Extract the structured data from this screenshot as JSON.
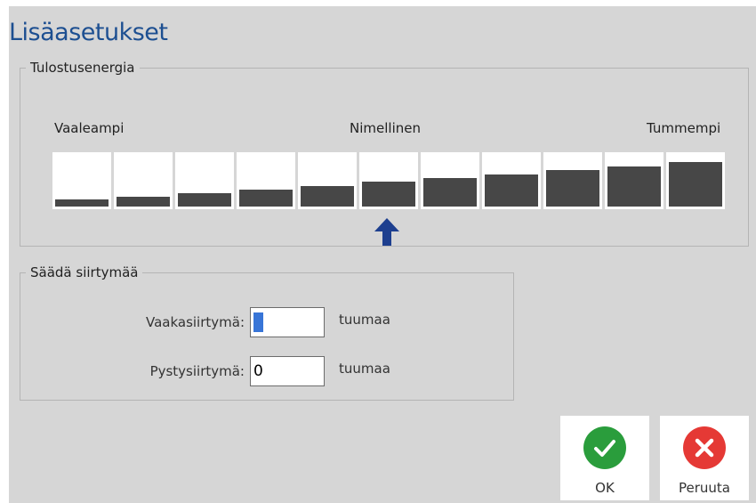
{
  "dialog": {
    "title": "Lisäasetukset"
  },
  "print_energy": {
    "legend": "Tulostusenergia",
    "label_lighter": "Vaaleampi",
    "label_nominal": "Nimellinen",
    "label_darker": "Tummempi",
    "levels": 11,
    "selected_index": 5,
    "colors": {
      "bar_fill": "#474747",
      "arrow": "#1d3f8f"
    }
  },
  "offset": {
    "legend": "Säädä siirtymää",
    "horizontal": {
      "label": "Vaakasiirtymä:",
      "value": "0",
      "unit": "tuumaa"
    },
    "vertical": {
      "label": "Pystysiirtymä:",
      "value": "0",
      "unit": "tuumaa"
    }
  },
  "buttons": {
    "ok": {
      "label": "OK",
      "icon": "check-icon",
      "color": "#2a9d3c"
    },
    "cancel": {
      "label": "Peruuta",
      "icon": "close-icon",
      "color": "#e53935"
    }
  }
}
